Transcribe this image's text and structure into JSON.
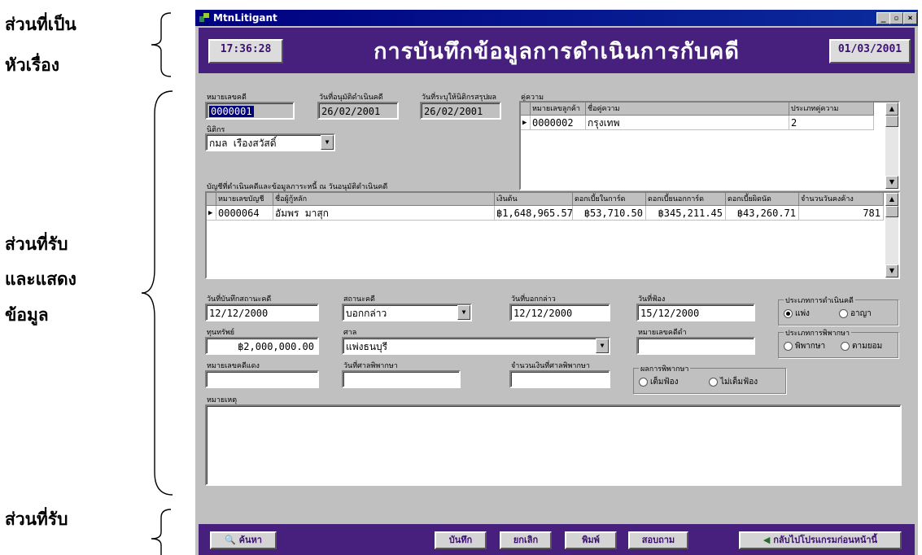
{
  "annotations": {
    "header_part_line1": "ส่วนที่เป็น",
    "header_part_line2": "หัวเรื่อง",
    "data_part_line1": "ส่วนที่รับ",
    "data_part_line2": "และแสดง",
    "data_part_line3": "ข้อมูล",
    "command_part_line1": "ส่วนที่รับ"
  },
  "window": {
    "title": "MtnLitigant",
    "minimize_glyph": "_",
    "maximize_glyph": "▫",
    "close_glyph": "×"
  },
  "header": {
    "time": "17:36:28",
    "title": "การบันทึกข้อมูลการดำเนินการกับคดี",
    "date": "01/03/2001"
  },
  "form": {
    "case_no_label": "หมายเลขคดี",
    "case_no": "0000001",
    "approve_date_label": "วันที่อนุมัติดำเนินคดี",
    "approve_date": "26/02/2001",
    "data_date_label": "วันที่ระบุให้นิติกรสรุปผล",
    "data_date": "26/02/2001",
    "lawyer_label": "นิติกร",
    "lawyer": "กมล เรืองสวัสดิ์",
    "parties_label": "คู่ความ",
    "parties_grid": {
      "headers": [
        "หมายเลขลูกค้า",
        "ชื่อคู่ความ",
        "ประเภทคู่ความ"
      ],
      "rows": [
        [
          "0000002",
          "กรุงเทพ",
          "2"
        ]
      ]
    },
    "accounts_label": "บัญชีที่ดำเนินคดีและข้อมูลภาระหนี้ ณ วันอนุมัติดำเนินคดี",
    "accounts_grid": {
      "headers": [
        "หมายเลขบัญชี",
        "ชื่อผู้กู้หลัก",
        "เงินต้น",
        "ดอกเบี้ยในการ์ด",
        "ดอกเบี้ยนอกการ์ด",
        "ดอกเบี้ยผิดนัด",
        "จำนวนวันคงค้าง"
      ],
      "rows": [
        [
          "0000064",
          "อัมพร มาสุก",
          "฿1,648,965.57",
          "฿53,710.50",
          "฿345,211.45",
          "฿43,260.71",
          "781"
        ]
      ]
    },
    "status_date_label": "วันที่บันทึกสถานะคดี",
    "status_date": "12/12/2000",
    "status_label": "สถานะคดี",
    "status": "บอกกล่าว",
    "notice_date_label": "วันที่บอกกล่าว",
    "notice_date": "12/12/2000",
    "sue_date_label": "วันที่ฟ้อง",
    "sue_date": "15/12/2000",
    "case_type_label": "ประเภทการดำเนินคดี",
    "case_type_civil": "แพ่ง",
    "case_type_criminal": "อาญา",
    "capital_label": "ทุนทรัพย์",
    "capital": "฿2,000,000.00",
    "court_label": "ศาล",
    "court": "แพ่งธนบุรี",
    "black_no_label": "หมายเลขคดีดำ",
    "black_no": "",
    "judgment_type_label": "ประเภทการพิพากษา",
    "judgment_type_judge": "พิพากษา",
    "judgment_type_compromise": "ตามยอม",
    "red_no_label": "หมายเลขคดีแดง",
    "red_no": "",
    "judgment_date_label": "วันที่ศาลพิพากษา",
    "judgment_date": "",
    "judgment_amount_label": "จำนวนเงินที่ศาลพิพากษา",
    "judgment_amount": "",
    "result_label": "ผลการพิพากษา",
    "result_full": "เต็มฟ้อง",
    "result_partial": "ไม่เต็มฟ้อง",
    "remarks_label": "หมายเหตุ",
    "remarks": ""
  },
  "footer": {
    "search": "ค้นหา",
    "save": "บันทึก",
    "cancel": "ยกเลิก",
    "print": "พิมพ์",
    "inquire": "สอบถาม",
    "back": "กลับไปโปรแกรมก่อนหน้านี้"
  },
  "colors": {
    "header_bg": "#471f7d",
    "title_bar": "#000080",
    "window_bg": "#c0c0c0"
  }
}
